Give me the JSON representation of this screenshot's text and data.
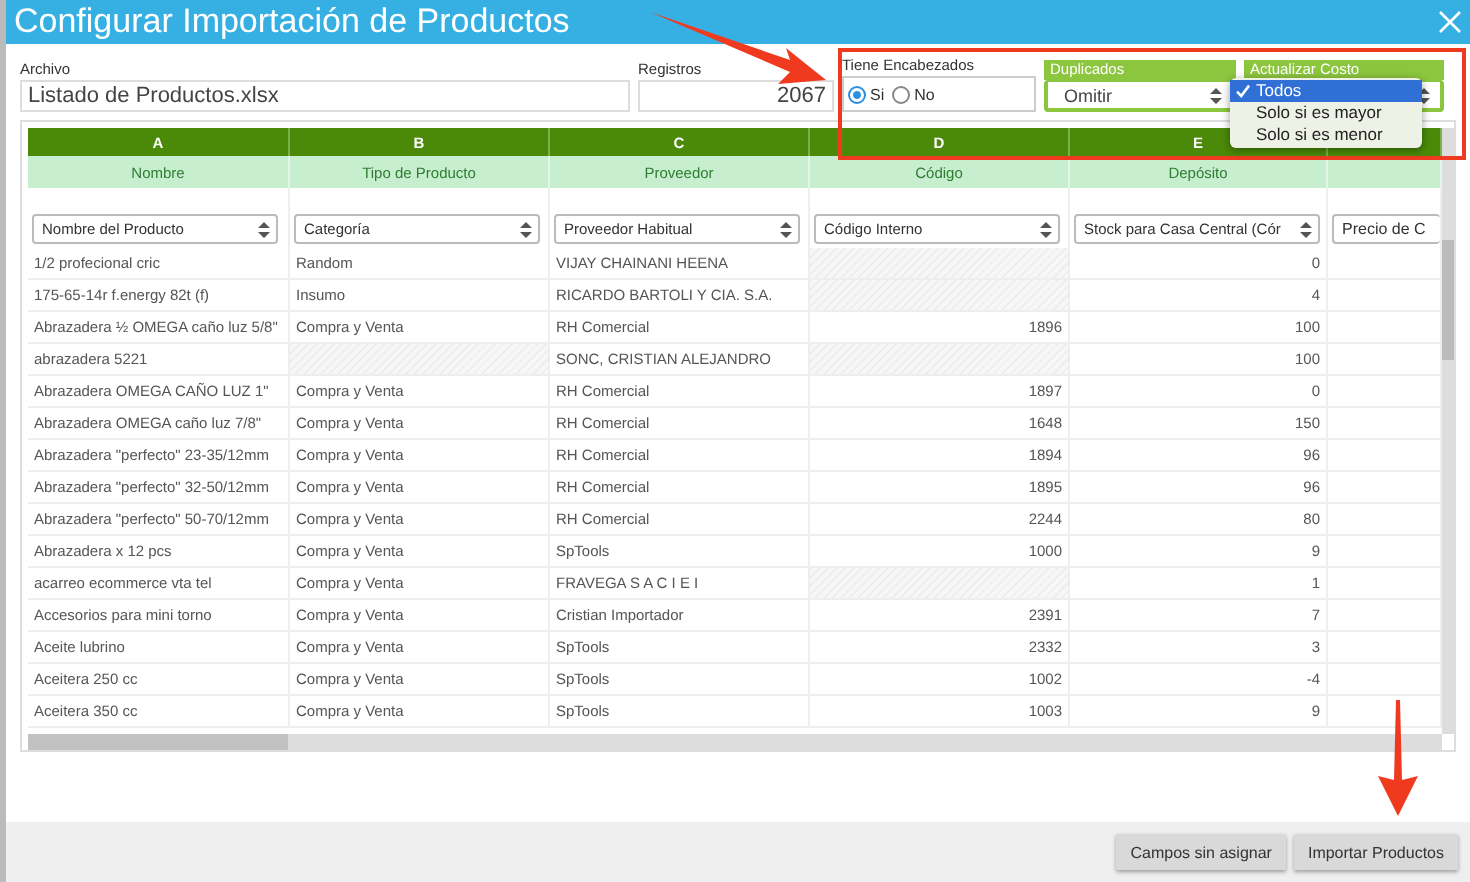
{
  "window": {
    "title": "Configurar Importación de Productos"
  },
  "archivo": {
    "label": "Archivo",
    "value": "Listado de Productos.xlsx"
  },
  "registros": {
    "label": "Registros",
    "value": "2067"
  },
  "encabezados": {
    "label": "Tiene Encabezados",
    "options": [
      {
        "label": "Si",
        "selected": true
      },
      {
        "label": "No",
        "selected": false
      }
    ]
  },
  "duplicados": {
    "label": "Duplicados",
    "value": "Omitir"
  },
  "actualizar_costo": {
    "label": "Actualizar Costo",
    "expanded": true,
    "options": [
      {
        "label": "Todos",
        "selected": true
      },
      {
        "label": "Solo si es mayor",
        "selected": false
      },
      {
        "label": "Solo si es menor",
        "selected": false
      }
    ]
  },
  "table": {
    "columns": [
      {
        "letter": "A",
        "field": "Nombre",
        "mapping": "Nombre del Producto"
      },
      {
        "letter": "B",
        "field": "Tipo de Producto",
        "mapping": "Categoría"
      },
      {
        "letter": "C",
        "field": "Proveedor",
        "mapping": "Proveedor Habitual"
      },
      {
        "letter": "D",
        "field": "Código",
        "mapping": "Código Interno"
      },
      {
        "letter": "E",
        "field": "Depósito",
        "mapping": "Stock para Casa Central (Cór"
      },
      {
        "mapping": "Precio de C"
      }
    ],
    "rows": [
      [
        "1/2 profecional cric",
        "Random",
        "VIJAY CHAINANI HEENA",
        null,
        "0"
      ],
      [
        "175-65-14r f.energy 82t (f)",
        "Insumo",
        "RICARDO BARTOLI Y CIA. S.A.",
        null,
        "4"
      ],
      [
        "Abrazadera ½ OMEGA caño luz 5/8\"",
        "Compra y Venta",
        "RH Comercial",
        "1896",
        "100"
      ],
      [
        "abrazadera 5221",
        null,
        "SONC, CRISTIAN ALEJANDRO",
        null,
        "100"
      ],
      [
        "Abrazadera OMEGA CAÑO LUZ 1\"",
        "Compra y Venta",
        "RH Comercial",
        "1897",
        "0"
      ],
      [
        "Abrazadera OMEGA caño luz 7/8\"",
        "Compra y Venta",
        "RH Comercial",
        "1648",
        "150"
      ],
      [
        "Abrazadera \"perfecto\" 23-35/12mm",
        "Compra y Venta",
        "RH Comercial",
        "1894",
        "96"
      ],
      [
        "Abrazadera \"perfecto\" 32-50/12mm",
        "Compra y Venta",
        "RH Comercial",
        "1895",
        "96"
      ],
      [
        "Abrazadera \"perfecto\" 50-70/12mm",
        "Compra y Venta",
        "RH Comercial",
        "2244",
        "80"
      ],
      [
        "Abrazadera x 12 pcs",
        "Compra y Venta",
        "SpTools",
        "1000",
        "9"
      ],
      [
        "acarreo ecommerce vta tel",
        "Compra y Venta",
        "FRAVEGA S A C I E I",
        null,
        "1"
      ],
      [
        "Accesorios para mini torno",
        "Compra y Venta",
        "Cristian Importador",
        "2391",
        "7"
      ],
      [
        "Aceite lubrino",
        "Compra y Venta",
        "SpTools",
        "2332",
        "3"
      ],
      [
        "Aceitera 250 cc",
        "Compra y Venta",
        "SpTools",
        "1002",
        "-4"
      ],
      [
        "Aceitera 350 cc",
        "Compra y Venta",
        "SpTools",
        "1003",
        "9"
      ]
    ]
  },
  "buttons": [
    "Campos sin asignar",
    "Importar Productos"
  ]
}
